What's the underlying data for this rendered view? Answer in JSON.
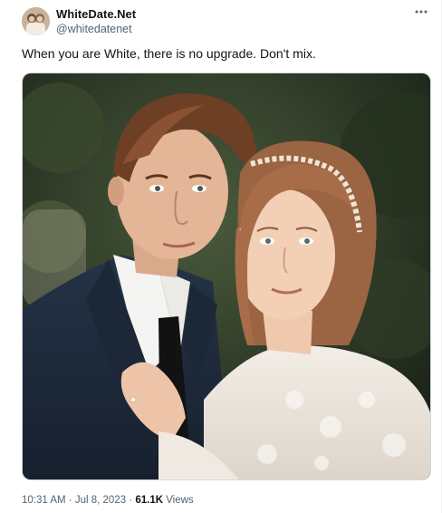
{
  "author": {
    "display_name": "WhiteDate.Net",
    "handle": "@whitedatenet"
  },
  "tweet": {
    "text": "When you are White, there is no upgrade. Don't mix."
  },
  "meta": {
    "time": "10:31 AM",
    "separator1": " · ",
    "date": "Jul 8, 2023",
    "separator2": " · ",
    "views_count": "61.1K",
    "views_label": " Views"
  },
  "colors": {
    "text_primary": "#0f1419",
    "text_secondary": "#536471",
    "border": "#cfd9de"
  },
  "icons": {
    "more": "more-horizontal-icon"
  }
}
